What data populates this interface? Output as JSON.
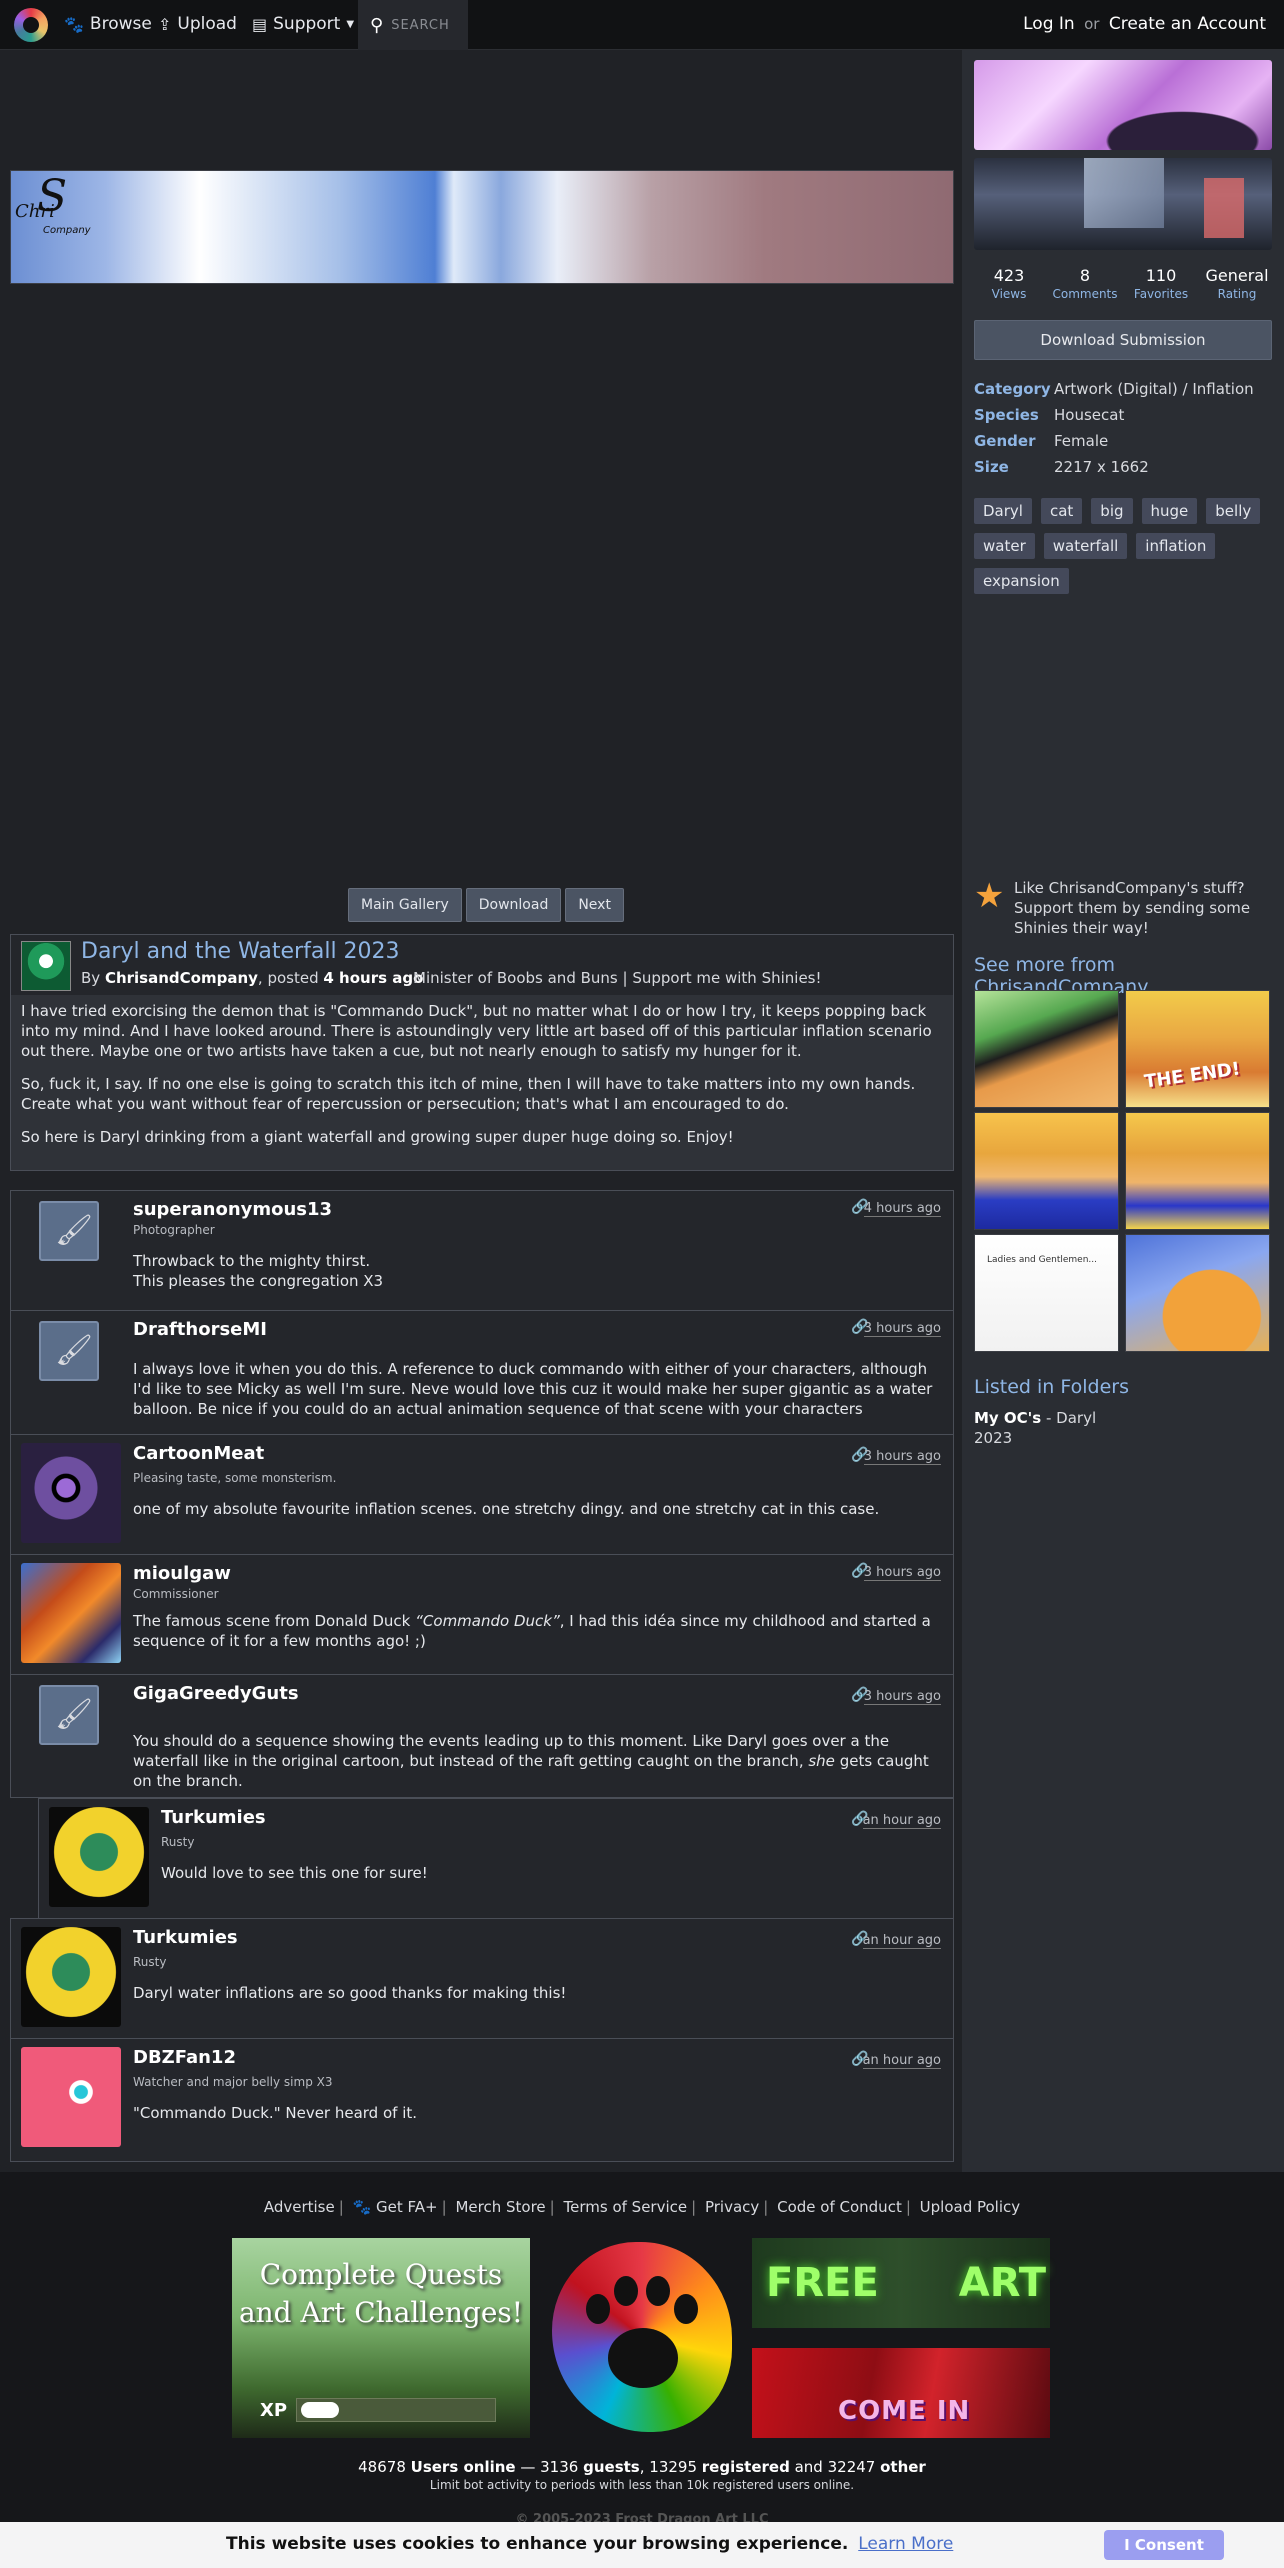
{
  "nav": {
    "browse": "Browse",
    "upload": "Upload",
    "support": "Support",
    "search_placeholder": "SEARCH",
    "login": "Log In",
    "or": "or",
    "create_account": "Create an Account"
  },
  "stats": [
    {
      "value": "423",
      "label": "Views"
    },
    {
      "value": "8",
      "label": "Comments"
    },
    {
      "value": "110",
      "label": "Favorites"
    },
    {
      "value": "General",
      "label": "Rating"
    }
  ],
  "download_button": "Download Submission",
  "info": [
    {
      "key": "Category",
      "value": "Artwork (Digital) / Inflation"
    },
    {
      "key": "Species",
      "value": "Housecat"
    },
    {
      "key": "Gender",
      "value": "Female"
    },
    {
      "key": "Size",
      "value": "2217 x 1662"
    }
  ],
  "tags": [
    "Daryl",
    "cat",
    "big",
    "huge",
    "belly",
    "water",
    "waterfall",
    "inflation",
    "expansion"
  ],
  "support_text": "Like ChrisandCompany's stuff? Support them by sending some Shinies their way!",
  "see_more": {
    "prefix": "See more from",
    "user": "ChrisandCompany"
  },
  "folders": {
    "title": "Listed in Folders",
    "folder": "My OC's",
    "item": " - Daryl 2023"
  },
  "banner_logo": {
    "s": "S",
    "c": "Chri",
    "cc": "Company"
  },
  "image_nav": {
    "gallery": "Main Gallery",
    "download": "Download",
    "next": "Next"
  },
  "submission": {
    "title": "Daryl and the Waterfall 2023",
    "by": "By",
    "author": "ChrisandCompany",
    "posted": ", posted",
    "time": "4 hours ago",
    "tagline": "Minister of Boobs and Buns | Support me with Shinies!",
    "desc1": "I have tried exorcising the demon that is \"Commando Duck\", but no matter what I do or how I try, it keeps popping back into my mind. And I have looked around. There is astoundingly very little art based off of this particular inflation scenario out there. Maybe one or two artists have taken a cue, but not nearly enough to satisfy my hunger for it.",
    "desc2": "So, fuck it, I say. If no one else is going to scratch this itch of mine, then I will have to take matters into my own hands. Create what you want without fear of repercussion or persecution; that's what I am encouraged to do.",
    "desc3": "So here is Daryl drinking from a giant waterfall and growing super duper huge doing so. Enjoy!"
  },
  "comments": [
    {
      "name": "superanonymous13",
      "title": "Photographer",
      "time": "4 hours ago",
      "text1": "Throwback to the mighty thirst.",
      "text2": "This pleases the congregation X3"
    },
    {
      "name": "DrafthorseMI",
      "title": "",
      "time": "3 hours ago",
      "text": "I always love it when you do this. A reference to duck commando with either of your characters, although I'd like to see Micky as well I'm sure. Neve would love this cuz it would make her super gigantic as a water balloon. Be nice if you could do an actual animation sequence of that scene with your characters"
    },
    {
      "name": "CartoonMeat",
      "title": "Pleasing taste, some monsterism.",
      "time": "3 hours ago",
      "text": "one of my absolute favourite inflation scenes. one stretchy dingy. and one stretchy cat in this case."
    },
    {
      "name": "mioulgaw",
      "title": "Commissioner",
      "time": "3 hours ago",
      "text_a": "The famous scene from Donald Duck ",
      "text_em": "“Commando Duck”",
      "text_b": ", I had this idéa since my childhood and started a sequence of it for a few months ago! ;)"
    },
    {
      "name": "GigaGreedyGuts",
      "title": "",
      "time": "3 hours ago",
      "text_a": "You should do a sequence showing the events leading up to this moment. Like Daryl goes over a the waterfall like in the original cartoon, but instead of the raft getting caught on the branch, ",
      "text_em": "she",
      "text_b": " gets caught on the branch."
    },
    {
      "name": "Turkumies",
      "title": "Rusty",
      "time": "an hour ago",
      "text": "Would love to see this one for sure!"
    },
    {
      "name": "Turkumies",
      "title": "Rusty",
      "time": "an hour ago",
      "text": "Daryl water inflations are so good thanks for making this!"
    },
    {
      "name": "DBZFan12",
      "title": "Watcher and major belly simp X3",
      "time": "an hour ago",
      "text": "\"Commando Duck.\" Never heard of it."
    }
  ],
  "footer": {
    "links": [
      "Advertise",
      "Get FA+",
      "Merch Store",
      "Terms of Service",
      "Privacy",
      "Code of Conduct",
      "Upload Policy"
    ],
    "ad1_text": "Complete Quests and Art Challenges!",
    "ad1_xp": "XP",
    "ad1_progress": 0.2,
    "ad2_t1": "FREE",
    "ad2_t2": "ART",
    "ad3_text": "COME IN",
    "online": {
      "total": "48678",
      "users_online": "Users online",
      "dash": " — ",
      "guests_n": "3136",
      "guests": "guests",
      "registered_n": "13295",
      "registered": "registered",
      "and": "and",
      "other_n": "32247",
      "other": "other"
    },
    "online_sub": "Limit bot activity to periods with less than 10k registered users online.",
    "copyright": "© 2005-2023 Frost Dragon Art LLC"
  },
  "cookie": {
    "text": "This website uses cookies to enhance your browsing experience.",
    "link": "Learn More",
    "button": "I Consent"
  },
  "colors": {
    "accent": "#8fb6e5",
    "background": "#202226",
    "sidebar": "#2a2d33",
    "button": "#4b5463"
  }
}
